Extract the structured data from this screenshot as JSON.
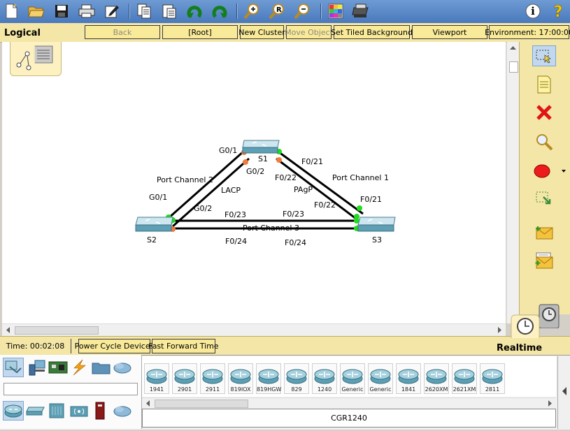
{
  "toolbar": {
    "icons": [
      "new-file-icon",
      "open-folder-icon",
      "save-icon",
      "print-icon",
      "activity-wizard-icon",
      "copy-icon",
      "paste-icon",
      "undo-icon",
      "redo-icon",
      "zoom-in-icon",
      "zoom-reset-icon",
      "zoom-out-icon",
      "palette-icon",
      "custom-device-icon",
      "info-icon",
      "help-icon"
    ],
    "info_label": "i",
    "help_label": "?"
  },
  "topbar": {
    "mode": "Logical",
    "back": "Back",
    "root": "[Root]",
    "new_cluster": "New Cluster",
    "move_object": "Move Object",
    "tiled_background": "Set Tiled Background",
    "viewport": "Viewport",
    "environment": "Environment: 17:00:00"
  },
  "topology": {
    "devices": [
      {
        "id": "S1",
        "label": "S1"
      },
      {
        "id": "S2",
        "label": "S2"
      },
      {
        "id": "S3",
        "label": "S3"
      }
    ],
    "labels": {
      "s1_g01": "G0/1",
      "s1_g02": "G0/2",
      "s1_f021": "F0/21",
      "s1_f022": "F0/22",
      "pc2": "Port Channel 2",
      "lacp": "LACP",
      "s2_g01": "G0/1",
      "s2_g02": "G0/2",
      "pc1": "Port Channel 1",
      "pagp": "PAgP",
      "s3_f021": "F0/21",
      "s3_f022": "F0/22",
      "s2_f023": "F0/23",
      "s3_f023": "F0/23",
      "pc3": "Port Channel 3",
      "s2_f024": "F0/24",
      "s3_f024": "F0/24"
    },
    "colors": {
      "up": "#1fdc1f",
      "down": "#f07b3c",
      "link": "#000000",
      "switch": "#5e9fb5"
    }
  },
  "rightpanel": {
    "tools": [
      "select-icon",
      "note-icon",
      "delete-icon",
      "inspect-icon",
      "draw-ellipse-icon",
      "resize-icon",
      "add-simple-pdu-icon",
      "add-complex-pdu-icon"
    ]
  },
  "status": {
    "time": "Time: 00:02:08",
    "power_cycle": "Power Cycle Devices",
    "fast_forward": "Fast Forward Time",
    "mode": "Realtime"
  },
  "categories": {
    "top": [
      "network-devices-icon",
      "end-devices-icon",
      "components-icon",
      "connections-icon",
      "miscellaneous-icon",
      "multiuser-icon"
    ],
    "bottom": [
      "routers-icon",
      "switches-icon",
      "hubs-icon",
      "wireless-icon",
      "security-icon",
      "wan-emulation-icon"
    ],
    "search_value": ""
  },
  "devices": [
    "1941",
    "2901",
    "2911",
    "819IOX",
    "819HGW",
    "829",
    "1240",
    "Generic",
    "Generic",
    "1841",
    "2620XM",
    "2621XM",
    "2811"
  ],
  "selected_device": "CGR1240"
}
